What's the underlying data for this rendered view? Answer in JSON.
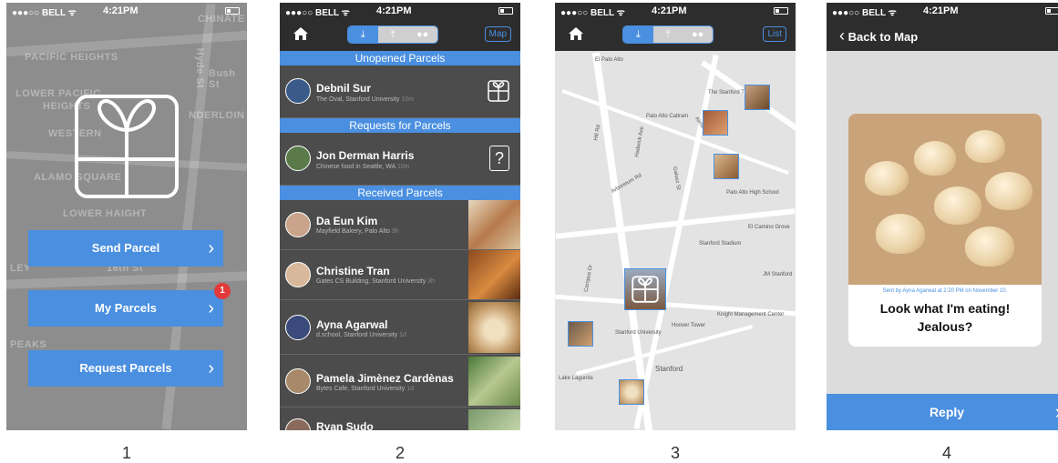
{
  "status": {
    "carrier": "●●●○○ BELL ᯤ",
    "time": "4:21PM"
  },
  "screen1": {
    "map_labels": [
      "PACIFIC HEIGHTS",
      "LOWER PACIFIC",
      "HEIGHTS",
      "WESTERN",
      "CHINATE",
      "NDERLOIN",
      "ALAMO SQUARE",
      "LOWER HAIGHT",
      "Bush St",
      "Hyde St",
      "16th St",
      "PEAKS",
      "LEY"
    ],
    "buttons": {
      "send": "Send Parcel",
      "my": "My Parcels",
      "request": "Request Parcels"
    },
    "badge": "1",
    "caption": "1"
  },
  "screen2": {
    "map_btn": "Map",
    "sections": {
      "unopened": "Unopened Parcels",
      "requests": "Requests for Parcels",
      "received": "Received Parcels"
    },
    "unopened": {
      "name": "Debnil Sur",
      "place": "The Oval, Stanford University",
      "time": "10m"
    },
    "request": {
      "name": "Jon Derman Harris",
      "place": "Chinese food in Seattle, WA",
      "time": "10m"
    },
    "received": [
      {
        "name": "Da Eun Kim",
        "place": "Mayfield Bakery, Palo Alto",
        "time": "3h"
      },
      {
        "name": "Christine Tran",
        "place": "Gates CS Building, Stanford University",
        "time": "3h"
      },
      {
        "name": "Ayna Agarwal",
        "place": "d.school, Stanford University",
        "time": "1d"
      },
      {
        "name": "Pamela Jimènez Cardènas",
        "place": "Bytes Cafe, Stanford University",
        "time": "1d"
      },
      {
        "name": "Ryan Sudo",
        "place": "",
        "time": ""
      }
    ],
    "question_mark": "?",
    "caption": "2"
  },
  "screen3": {
    "list_btn": "List",
    "labels": [
      "El Palo Alto",
      "The Stanford Theatre",
      "Palo Alto Caltrain",
      "Palo Alto High School",
      "El Camino Grove",
      "Stanford Stadium",
      "Stanford University",
      "Hoover Tower",
      "Knight Management Center",
      "Stanford",
      "Lake Lagunita",
      "JM Stanford",
      "Hadwick Ave",
      "Hill Rd",
      "Arboretum Rd",
      "Alma St",
      "Campus Dr",
      "Galvez St"
    ],
    "caption": "3"
  },
  "screen4": {
    "back": "Back to Map",
    "sent_by": "Sent by Ayna Agarwal at 2:20 PM on November 10.",
    "message_line1": "Look what I'm eating!",
    "message_line2": "Jealous?",
    "reply": "Reply",
    "caption": "4"
  },
  "colors": {
    "accent": "#4a8fe0",
    "dark": "#2d2d2d",
    "badge": "#e23a3a"
  }
}
